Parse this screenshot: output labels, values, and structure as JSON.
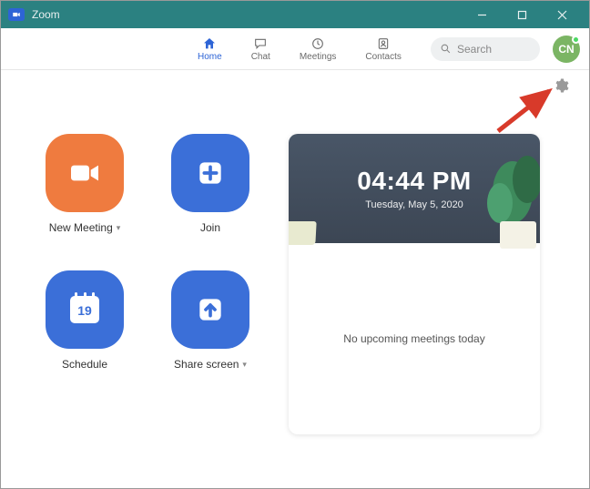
{
  "window": {
    "title": "Zoom"
  },
  "nav": {
    "home": "Home",
    "chat": "Chat",
    "meetings": "Meetings",
    "contacts": "Contacts"
  },
  "search": {
    "placeholder": "Search"
  },
  "user": {
    "initials": "CN"
  },
  "tiles": {
    "new_meeting": "New Meeting",
    "join": "Join",
    "schedule": "Schedule",
    "schedule_day": "19",
    "share_screen": "Share screen"
  },
  "info": {
    "time": "04:44 PM",
    "date": "Tuesday, May 5, 2020",
    "empty": "No upcoming meetings today"
  }
}
